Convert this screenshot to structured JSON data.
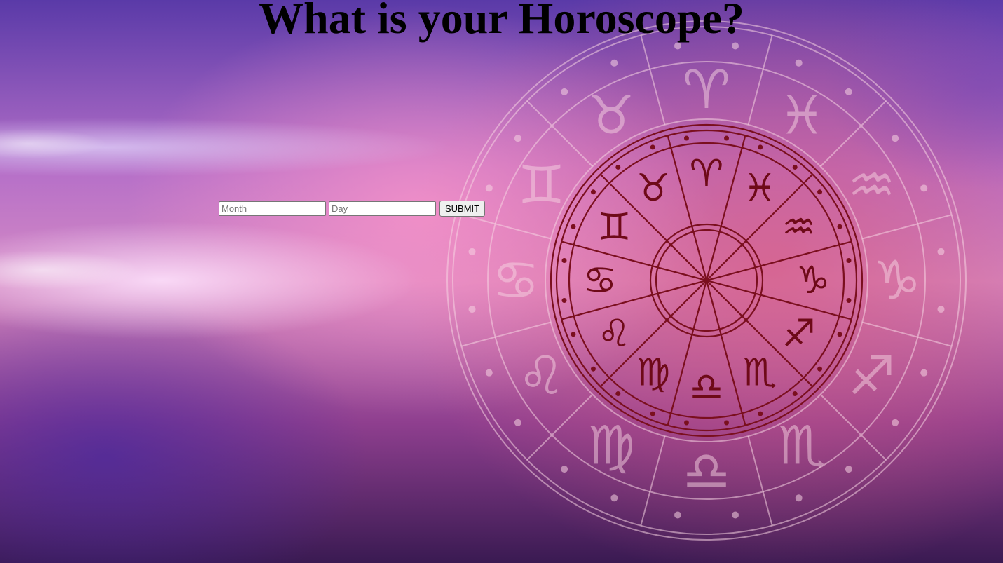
{
  "page": {
    "title": "What is your Horoscope?"
  },
  "form": {
    "month_placeholder": "Month",
    "month_value": "",
    "day_placeholder": "Day",
    "day_value": "",
    "submit_label": "SUBMIT"
  },
  "background": {
    "image": "zodiac-wheel",
    "outer_ring_glyphs": [
      "♈",
      "♓",
      "♒",
      "♑",
      "♐",
      "♏",
      "♎",
      "♍",
      "♌",
      "♋",
      "♊",
      "♉"
    ],
    "inner_ring_glyphs": [
      "♈",
      "♓",
      "♒",
      "♑",
      "♐",
      "♏",
      "♎",
      "♍",
      "♌",
      "♋",
      "♊",
      "♉"
    ],
    "colors": {
      "inner_wheel": "#7a0f1e",
      "outer_wheel": "#f6d3e2"
    }
  }
}
